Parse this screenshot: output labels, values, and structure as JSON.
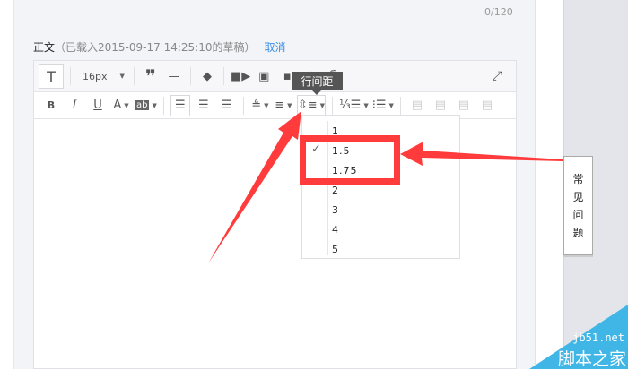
{
  "counter": "0/120",
  "body_label": {
    "title": "正文",
    "draft_note": "（已载入2015-09-17 14:25:10的草稿）",
    "cancel": "取消"
  },
  "toolbar": {
    "font_size": "16px",
    "tooltip": "行间距"
  },
  "line_height_menu": {
    "selected": "1.5",
    "options": [
      "1",
      "1.5",
      "1.75",
      "2",
      "3",
      "4",
      "5"
    ]
  },
  "faq": [
    "常",
    "见",
    "问",
    "题"
  ],
  "watermark": {
    "site": "jb51.net",
    "name": "脚本之家"
  },
  "colors": {
    "accent": "#3a8ee6",
    "annotation": "#ff3b3b",
    "watermark": "#3fb6e6"
  }
}
